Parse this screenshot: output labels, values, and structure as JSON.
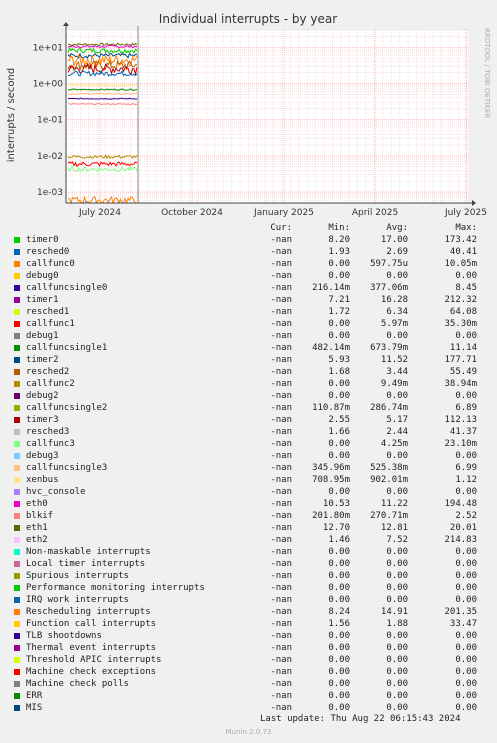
{
  "chart_data": {
    "type": "line",
    "title": "Individual interrupts - by year",
    "ylabel": "interrupts / second",
    "y_scale": "log",
    "ylim": [
      0.0005,
      30
    ],
    "y_ticks": [
      "1e+01",
      "1e+00",
      "1e-01",
      "1e-02",
      "1e-03"
    ],
    "x_ticks": [
      "July 2024",
      "October 2024",
      "January 2025",
      "April 2025",
      "July 2025"
    ],
    "watermark": "RRDTOOL / TOBI OETIKER",
    "grid": true,
    "series_band_levels": [
      8.2,
      5.93,
      4.5,
      0.7,
      0.5,
      0.38,
      0.01,
      0.007,
      0.005,
      0.0006
    ],
    "columns": [
      "Cur:",
      "Min:",
      "Avg:",
      "Max:"
    ],
    "series": [
      {
        "name": "timer0",
        "color": "#00cc00",
        "cur": "-nan",
        "min": "8.20",
        "avg": "17.00",
        "max": "173.42"
      },
      {
        "name": "resched0",
        "color": "#0066b3",
        "cur": "-nan",
        "min": "1.93",
        "avg": "2.69",
        "max": "40.41"
      },
      {
        "name": "callfunc0",
        "color": "#ff8000",
        "cur": "-nan",
        "min": "0.00",
        "avg": "597.75u",
        "max": "10.05m"
      },
      {
        "name": "debug0",
        "color": "#ffcc00",
        "cur": "-nan",
        "min": "0.00",
        "avg": "0.00",
        "max": "0.00"
      },
      {
        "name": "callfuncsingle0",
        "color": "#330099",
        "cur": "-nan",
        "min": "216.14m",
        "avg": "377.06m",
        "max": "8.45"
      },
      {
        "name": "timer1",
        "color": "#990099",
        "cur": "-nan",
        "min": "7.21",
        "avg": "16.28",
        "max": "212.32"
      },
      {
        "name": "resched1",
        "color": "#ccff00",
        "cur": "-nan",
        "min": "1.72",
        "avg": "6.34",
        "max": "64.08"
      },
      {
        "name": "callfunc1",
        "color": "#ff0000",
        "cur": "-nan",
        "min": "0.00",
        "avg": "5.97m",
        "max": "35.30m"
      },
      {
        "name": "debug1",
        "color": "#808080",
        "cur": "-nan",
        "min": "0.00",
        "avg": "0.00",
        "max": "0.00"
      },
      {
        "name": "callfuncsingle1",
        "color": "#008f00",
        "cur": "-nan",
        "min": "482.14m",
        "avg": "673.79m",
        "max": "11.14"
      },
      {
        "name": "timer2",
        "color": "#00487d",
        "cur": "-nan",
        "min": "5.93",
        "avg": "11.52",
        "max": "177.71"
      },
      {
        "name": "resched2",
        "color": "#b35a00",
        "cur": "-nan",
        "min": "1.68",
        "avg": "3.44",
        "max": "55.49"
      },
      {
        "name": "callfunc2",
        "color": "#b38f00",
        "cur": "-nan",
        "min": "0.00",
        "avg": "9.49m",
        "max": "38.94m"
      },
      {
        "name": "debug2",
        "color": "#6b006b",
        "cur": "-nan",
        "min": "0.00",
        "avg": "0.00",
        "max": "0.00"
      },
      {
        "name": "callfuncsingle2",
        "color": "#8fb300",
        "cur": "-nan",
        "min": "110.87m",
        "avg": "286.74m",
        "max": "6.89"
      },
      {
        "name": "timer3",
        "color": "#b30000",
        "cur": "-nan",
        "min": "2.55",
        "avg": "5.17",
        "max": "112.13"
      },
      {
        "name": "resched3",
        "color": "#bebebe",
        "cur": "-nan",
        "min": "1.66",
        "avg": "2.44",
        "max": "41.37"
      },
      {
        "name": "callfunc3",
        "color": "#80ff80",
        "cur": "-nan",
        "min": "0.00",
        "avg": "4.25m",
        "max": "23.10m"
      },
      {
        "name": "debug3",
        "color": "#80c9ff",
        "cur": "-nan",
        "min": "0.00",
        "avg": "0.00",
        "max": "0.00"
      },
      {
        "name": "callfuncsingle3",
        "color": "#ffc080",
        "cur": "-nan",
        "min": "345.96m",
        "avg": "525.38m",
        "max": "6.99"
      },
      {
        "name": "xenbus",
        "color": "#ffe680",
        "cur": "-nan",
        "min": "708.95m",
        "avg": "902.01m",
        "max": "1.12"
      },
      {
        "name": "hvc_console",
        "color": "#aa80ff",
        "cur": "-nan",
        "min": "0.00",
        "avg": "0.00",
        "max": "0.00"
      },
      {
        "name": "eth0",
        "color": "#ee00cc",
        "cur": "-nan",
        "min": "10.53",
        "avg": "11.22",
        "max": "194.48"
      },
      {
        "name": "blkif",
        "color": "#ff8080",
        "cur": "-nan",
        "min": "201.80m",
        "avg": "270.71m",
        "max": "2.52"
      },
      {
        "name": "eth1",
        "color": "#666600",
        "cur": "-nan",
        "min": "12.70",
        "avg": "12.81",
        "max": "20.01"
      },
      {
        "name": "eth2",
        "color": "#ffbfff",
        "cur": "-nan",
        "min": "1.46",
        "avg": "7.52",
        "max": "214.83"
      },
      {
        "name": "Non-maskable interrupts",
        "color": "#00ffcc",
        "cur": "-nan",
        "min": "0.00",
        "avg": "0.00",
        "max": "0.00"
      },
      {
        "name": "Local timer interrupts",
        "color": "#cc6699",
        "cur": "-nan",
        "min": "0.00",
        "avg": "0.00",
        "max": "0.00"
      },
      {
        "name": "Spurious interrupts",
        "color": "#999900",
        "cur": "-nan",
        "min": "0.00",
        "avg": "0.00",
        "max": "0.00"
      },
      {
        "name": "Performance monitoring interrupts",
        "color": "#00cc00",
        "cur": "-nan",
        "min": "0.00",
        "avg": "0.00",
        "max": "0.00"
      },
      {
        "name": "IRQ work interrupts",
        "color": "#0066b3",
        "cur": "-nan",
        "min": "0.00",
        "avg": "0.00",
        "max": "0.00"
      },
      {
        "name": "Rescheduling interrupts",
        "color": "#ff8000",
        "cur": "-nan",
        "min": "8.24",
        "avg": "14.91",
        "max": "201.35"
      },
      {
        "name": "Function call interrupts",
        "color": "#ffcc00",
        "cur": "-nan",
        "min": "1.56",
        "avg": "1.88",
        "max": "33.47"
      },
      {
        "name": "TLB shootdowns",
        "color": "#330099",
        "cur": "-nan",
        "min": "0.00",
        "avg": "0.00",
        "max": "0.00"
      },
      {
        "name": "Thermal event interrupts",
        "color": "#990099",
        "cur": "-nan",
        "min": "0.00",
        "avg": "0.00",
        "max": "0.00"
      },
      {
        "name": "Threshold APIC interrupts",
        "color": "#ccff00",
        "cur": "-nan",
        "min": "0.00",
        "avg": "0.00",
        "max": "0.00"
      },
      {
        "name": "Machine check exceptions",
        "color": "#ff0000",
        "cur": "-nan",
        "min": "0.00",
        "avg": "0.00",
        "max": "0.00"
      },
      {
        "name": "Machine check polls",
        "color": "#808080",
        "cur": "-nan",
        "min": "0.00",
        "avg": "0.00",
        "max": "0.00"
      },
      {
        "name": "ERR",
        "color": "#008f00",
        "cur": "-nan",
        "min": "0.00",
        "avg": "0.00",
        "max": "0.00"
      },
      {
        "name": "MIS",
        "color": "#00487d",
        "cur": "-nan",
        "min": "0.00",
        "avg": "0.00",
        "max": "0.00"
      }
    ]
  },
  "last_update": "Last update: Thu Aug 22 06:15:43 2024",
  "footer": "Munin 2.0.73"
}
